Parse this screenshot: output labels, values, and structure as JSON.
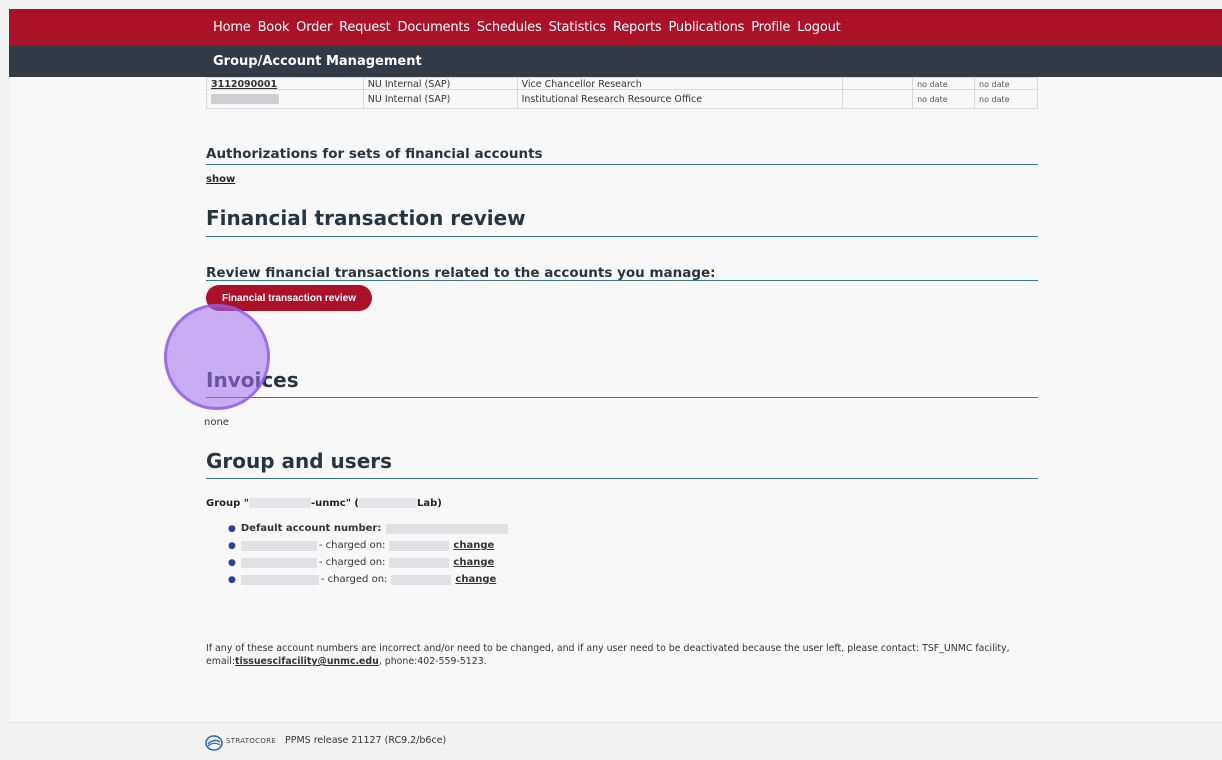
{
  "nav": {
    "items": [
      "Home",
      "Book",
      "Order",
      "Request",
      "Documents",
      "Schedules",
      "Statistics",
      "Reports",
      "Publications",
      "Profile",
      "Logout"
    ]
  },
  "subbar": {
    "title": "Group/Account Management"
  },
  "accounts_table": {
    "rows": [
      {
        "account": "3112090001",
        "type": "NU Internal (SAP)",
        "description": "Vice Chancellor Research",
        "start": "no date",
        "end": "no date"
      },
      {
        "account": "",
        "type": "NU Internal (SAP)",
        "description": "Institutional Research Resource Office",
        "start": "no date",
        "end": "no date"
      }
    ]
  },
  "authorizations": {
    "heading": "Authorizations for sets of financial accounts",
    "show_link": "show"
  },
  "financial_review": {
    "heading": "Financial transaction review",
    "subheading": "Review financial transactions related to the accounts you manage:",
    "button": "Financial transaction review"
  },
  "invoices": {
    "heading": "Invoices",
    "value": "none"
  },
  "group_users": {
    "heading": "Group and users",
    "group_prefix": "Group \"",
    "group_mid": "-unmc\" (",
    "group_suffix": "Lab)",
    "default_account_label": "Default account number:",
    "charged_on_label": "- charged on:",
    "change_label": "change"
  },
  "contact": {
    "line1": "If any of these account numbers are incorrect and/or need to be changed, and if any user need to be deactivated because the user left, please contact: TSF_UNMC facility,",
    "email_prefix": "email:",
    "email": "tissuescifacility@unmc.edu",
    "phone": ", phone:402-559-5123."
  },
  "footer": {
    "brand": "STRATOCORE",
    "release": "PPMS release 21127 (RC9.2/b6ce)"
  },
  "colors": {
    "nav": "#ab1128",
    "subbar": "#323b45",
    "heading": "#253641",
    "rule": "#3c7a8a",
    "cursor": "#a06ef0"
  }
}
